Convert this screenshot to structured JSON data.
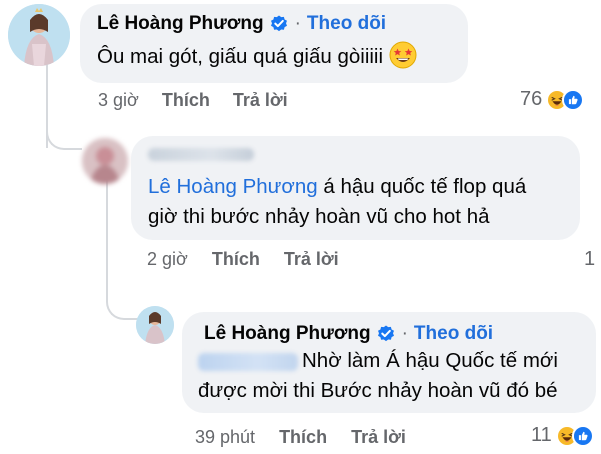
{
  "comment": {
    "author": "Lê Hoàng Phương",
    "follow": "Theo dõi",
    "separator": "·",
    "text": "Ôu mai gót, giấu quá giấu gòiiiii",
    "emoji": "star-struck-emoji",
    "time": "3 giờ",
    "like": "Thích",
    "reply": "Trả lời",
    "reaction_count": "76",
    "reaction_icons": [
      "haha-reaction-icon",
      "like-reaction-icon"
    ]
  },
  "reply1": {
    "author": "",
    "mention": "Lê Hoàng Phương",
    "text_line1": " á hậu quốc tế flop quá",
    "text_line2": "giờ thi bước nhảy hoàn vũ cho hot hả",
    "time": "2 giờ",
    "like": "Thích",
    "reply": "Trả lời",
    "reaction_count": "1"
  },
  "reply2": {
    "author": "Lê Hoàng Phương",
    "follow": "Theo dõi",
    "separator": "·",
    "text_line1": "Nhờ làm Á hậu Quốc tế mới",
    "text_line2": "được mời thi Bước nhảy hoàn vũ đó bé",
    "time": "39 phút",
    "like": "Thích",
    "reply": "Trả lời",
    "reaction_count": "11",
    "reaction_icons": [
      "haha-reaction-icon",
      "like-reaction-icon"
    ]
  },
  "colors": {
    "accent_blue": "#216fdb",
    "bubble": "#f0f2f5",
    "meta_gray": "#65676b"
  }
}
